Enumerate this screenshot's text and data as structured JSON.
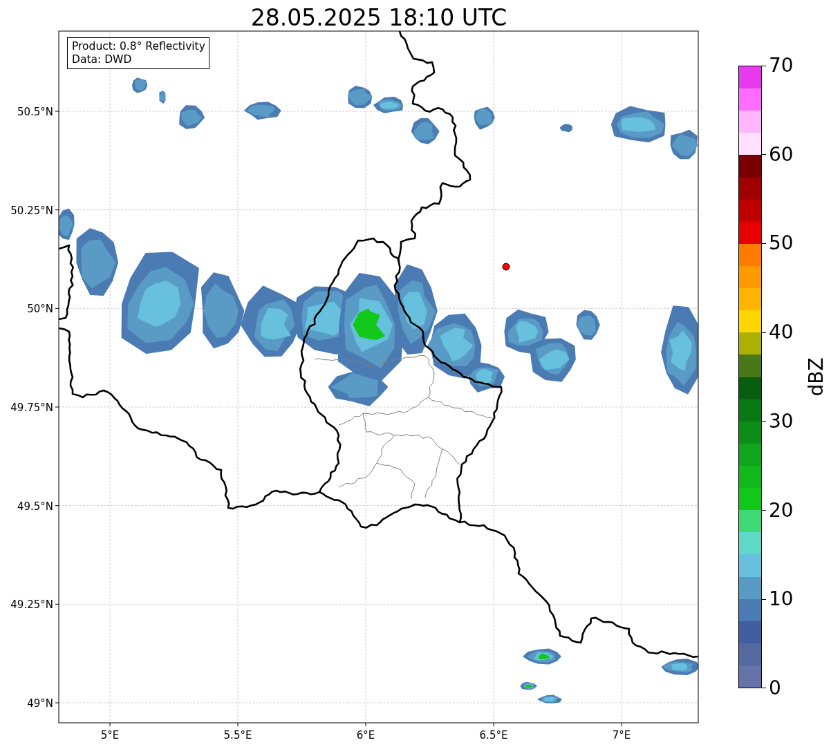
{
  "title": "28.05.2025 18:10 UTC",
  "info_box": [
    "Product: 0.8° Reflectivity",
    "Data: DWD"
  ],
  "map": {
    "x_tick_labels": [
      "5°E",
      "5.5°E",
      "6°E",
      "6.5°E",
      "7°E"
    ],
    "y_tick_labels": [
      "50.5°N",
      "50.25°N",
      "50°N",
      "49.75°N",
      "49.5°N",
      "49.25°N",
      "49°N"
    ]
  },
  "colorbar": {
    "label": "dBZ",
    "tick_labels": [
      "70",
      "60",
      "50",
      "40",
      "30",
      "20",
      "10",
      "0"
    ],
    "bands": [
      {
        "color": "#e83aed"
      },
      {
        "color": "#ff6cff"
      },
      {
        "color": "#ffb6ff"
      },
      {
        "color": "#ffe0ff"
      },
      {
        "color": "#780000"
      },
      {
        "color": "#a00000"
      },
      {
        "color": "#c00000"
      },
      {
        "color": "#e60000"
      },
      {
        "color": "#ff7a00"
      },
      {
        "color": "#ff9900"
      },
      {
        "color": "#ffb400"
      },
      {
        "color": "#ffd700"
      },
      {
        "color": "#adb005"
      },
      {
        "color": "#487817"
      },
      {
        "color": "#075e0e"
      },
      {
        "color": "#097a13"
      },
      {
        "color": "#0c8e16"
      },
      {
        "color": "#10a51a"
      },
      {
        "color": "#10b81a"
      },
      {
        "color": "#12c81a"
      },
      {
        "color": "#3ed874"
      },
      {
        "color": "#5fd8c6"
      },
      {
        "color": "#67c0de"
      },
      {
        "color": "#5a9bc6"
      },
      {
        "color": "#4a7bb2"
      },
      {
        "color": "#425ea0"
      },
      {
        "color": "#53699f"
      },
      {
        "color": "#6474a8"
      }
    ]
  }
}
